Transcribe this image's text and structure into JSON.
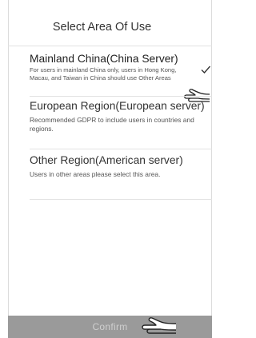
{
  "header": {
    "title": "Select Area Of Use"
  },
  "options": [
    {
      "title": "Mainland China(China Server)",
      "description": "For users in mainland China only, users in Hong Kong, Macau, and Taiwan in China should use Other Areas",
      "selected": true
    },
    {
      "title": "European Region(European server)",
      "description": "Recommended GDPR to include users in countries and regions.",
      "selected": false
    },
    {
      "title": "Other Region(American server)",
      "description": "Users in other areas please select this area.",
      "selected": false
    }
  ],
  "footer": {
    "confirm_label": "Confirm"
  },
  "icons": {
    "check": "check-icon",
    "pointer": "hand-pointer-icon"
  }
}
